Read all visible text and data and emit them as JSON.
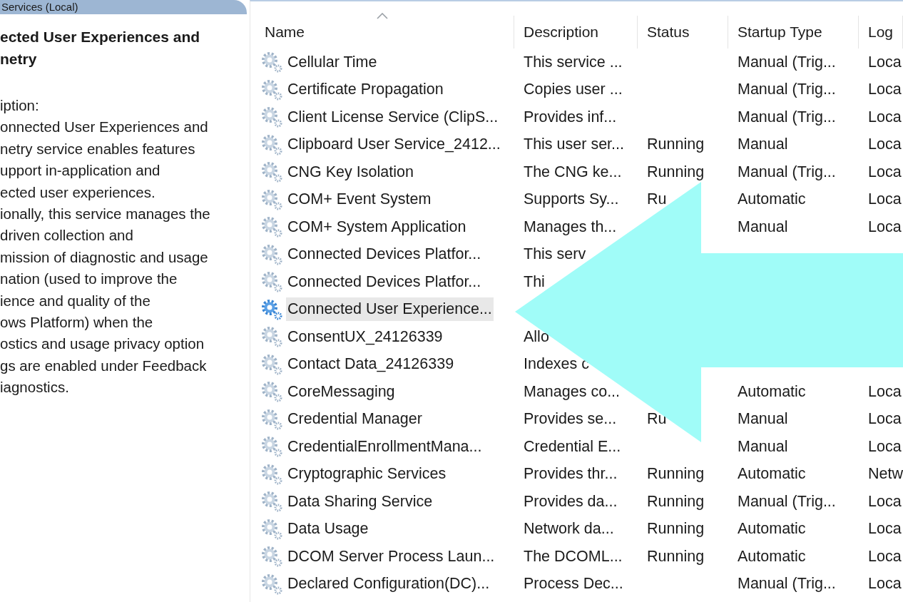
{
  "pane_tab": {
    "title": "Services (Local)"
  },
  "detail": {
    "title_lines": [
      "ected User Experiences and",
      "netry"
    ],
    "description_lines": [
      "iption:",
      "onnected User Experiences and",
      "netry service enables features",
      "upport in-application and",
      "ected user experiences.",
      "ionally, this service manages the",
      "driven collection and",
      "mission of diagnostic and usage",
      "nation (used to improve the",
      "ience and quality of the",
      "ows Platform) when the",
      "ostics and usage privacy option",
      "gs are enabled under Feedback",
      "iagnostics."
    ]
  },
  "table": {
    "columns": [
      {
        "label": "Name",
        "sorted": true
      },
      {
        "label": "Description",
        "sorted": false
      },
      {
        "label": "Status",
        "sorted": false
      },
      {
        "label": "Startup Type",
        "sorted": false
      },
      {
        "label": "Log",
        "sorted": false
      }
    ],
    "rows": [
      {
        "name": "Cellular Time",
        "description": "This service ...",
        "startup": "Manual (Trig...",
        "log": "Loca",
        "selected": false
      },
      {
        "name": "Certificate Propagation",
        "description": "Copies user ...",
        "startup": "Manual (Trig...",
        "log": "Loca",
        "selected": false
      },
      {
        "name": "Client License Service (ClipS...",
        "description": "Provides inf...",
        "startup": "Manual (Trig...",
        "log": "Loca",
        "selected": false
      },
      {
        "name": "Clipboard User Service_2412...",
        "description": "This user ser...",
        "status": "Running",
        "startup": "Manual",
        "log": "Loca",
        "selected": false
      },
      {
        "name": "CNG Key Isolation",
        "description": "The CNG ke...",
        "status": "Running",
        "startup": "Manual (Trig...",
        "log": "Loca",
        "selected": false
      },
      {
        "name": "COM+ Event System",
        "description": "Supports Sy...",
        "status": "Ru",
        "startup": "Automatic",
        "log": "Loca",
        "selected": false
      },
      {
        "name": "COM+ System Application",
        "description": "Manages th...",
        "startup": "Manual",
        "log": "Loca",
        "selected": false
      },
      {
        "name": "Connected Devices Platfor...",
        "description": "This serv",
        "selected": false
      },
      {
        "name": "Connected Devices Platfor...",
        "description": "Thi",
        "selected": false
      },
      {
        "name": "Connected User Experience...",
        "selected": true
      },
      {
        "name": "ConsentUX_24126339",
        "description": "Allo",
        "selected": false
      },
      {
        "name": "Contact Data_24126339",
        "description": "Indexes c",
        "selected": false
      },
      {
        "name": "CoreMessaging",
        "description": "Manages co...",
        "startup": "Automatic",
        "log": "Loca",
        "selected": false
      },
      {
        "name": "Credential Manager",
        "description": "Provides se...",
        "status": "Ru",
        "startup": "Manual",
        "log": "Loca",
        "selected": false
      },
      {
        "name": "CredentialEnrollmentMana...",
        "description": "Credential E...",
        "startup": "Manual",
        "log": "Loca",
        "selected": false
      },
      {
        "name": "Cryptographic Services",
        "description": "Provides thr...",
        "status": "Running",
        "startup": "Automatic",
        "log": "Netw",
        "selected": false
      },
      {
        "name": "Data Sharing Service",
        "description": "Provides da...",
        "status": "Running",
        "startup": "Manual (Trig...",
        "log": "Loca",
        "selected": false
      },
      {
        "name": "Data Usage",
        "description": "Network da...",
        "status": "Running",
        "startup": "Automatic",
        "log": "Loca",
        "selected": false
      },
      {
        "name": "DCOM Server Process Laun...",
        "description": "The DCOML...",
        "status": "Running",
        "startup": "Automatic",
        "log": "Loca",
        "selected": false
      },
      {
        "name": "Declared Configuration(DC)...",
        "description": "Process Dec...",
        "startup": "Manual (Trig...",
        "log": "Loca",
        "selected": false
      }
    ]
  }
}
